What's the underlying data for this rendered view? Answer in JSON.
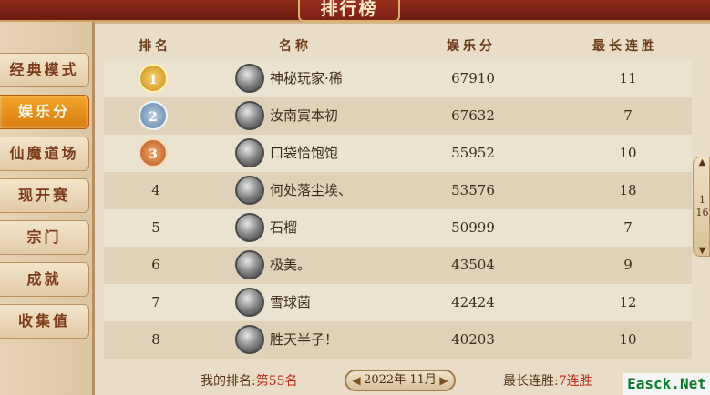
{
  "title": "排行榜",
  "tabs": [
    {
      "label": "经典模式",
      "active": false
    },
    {
      "label": "娱乐分",
      "active": true
    },
    {
      "label": "仙魔道场",
      "active": false
    },
    {
      "label": "现开赛",
      "active": false
    },
    {
      "label": "宗门",
      "active": false
    },
    {
      "label": "成就",
      "active": false
    },
    {
      "label": "收集值",
      "active": false
    }
  ],
  "columns": {
    "rank": "排名",
    "name": "名称",
    "score": "娱乐分",
    "streak": "最长连胜"
  },
  "rows": [
    {
      "rank": "1",
      "medal": "gold",
      "name": "神秘玩家·稀",
      "score": "67910",
      "streak": "11"
    },
    {
      "rank": "2",
      "medal": "silver",
      "name": "汝南寅本初",
      "score": "67632",
      "streak": "7"
    },
    {
      "rank": "3",
      "medal": "bronze",
      "name": "口袋恰饱饱",
      "score": "55952",
      "streak": "10"
    },
    {
      "rank": "4",
      "medal": "",
      "name": "何处落尘埃、",
      "score": "53576",
      "streak": "18"
    },
    {
      "rank": "5",
      "medal": "",
      "name": "石榴",
      "score": "50999",
      "streak": "7"
    },
    {
      "rank": "6",
      "medal": "",
      "name": "极美。",
      "score": "43504",
      "streak": "9"
    },
    {
      "rank": "7",
      "medal": "",
      "name": "雪球菌",
      "score": "42424",
      "streak": "12"
    },
    {
      "rank": "8",
      "medal": "",
      "name": "胜天半子！",
      "score": "40203",
      "streak": "10"
    }
  ],
  "footer": {
    "my_rank_label": "我的排名:",
    "my_rank_value": "第55名",
    "month": "2022年 11月",
    "streak_label": "最长连胜:",
    "streak_value": "7连胜"
  },
  "pager": {
    "current": "1",
    "total": "16"
  },
  "watermark": "Easck.Net",
  "colors": {
    "accent_tab": "#e88f1c",
    "highlight": "#c0281e",
    "board_bg": "#e9ddc7"
  }
}
